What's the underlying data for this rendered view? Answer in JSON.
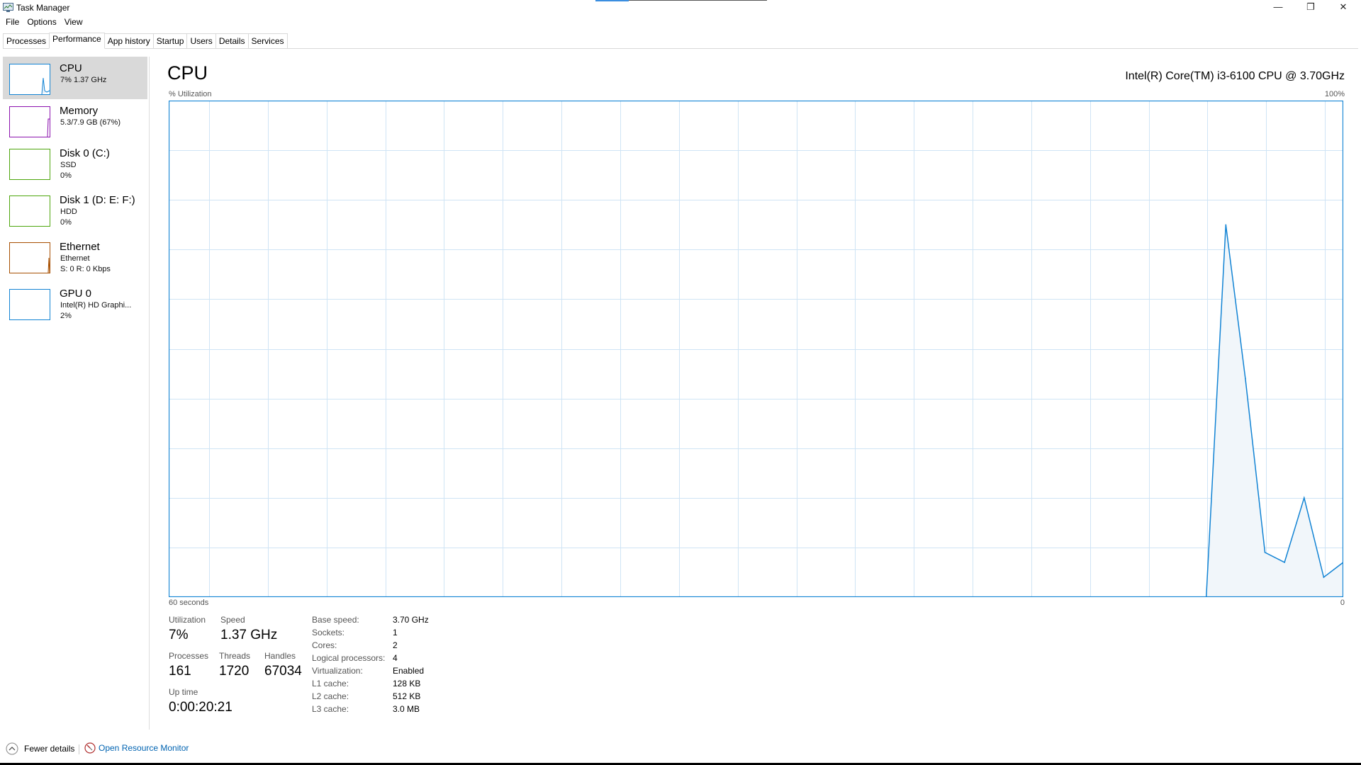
{
  "window": {
    "title": "Task Manager",
    "controls": {
      "minimize": "—",
      "restore": "❐",
      "close": "✕"
    }
  },
  "menu": [
    "File",
    "Options",
    "View"
  ],
  "tabs": [
    "Processes",
    "Performance",
    "App history",
    "Startup",
    "Users",
    "Details",
    "Services"
  ],
  "active_tab": "Performance",
  "sidebar": [
    {
      "name": "CPU",
      "line1": "7% 1.37 GHz",
      "line2": "",
      "color": "#1183d4",
      "selected": true
    },
    {
      "name": "Memory",
      "line1": "5.3/7.9 GB (67%)",
      "line2": "",
      "color": "#8b12ae",
      "selected": false
    },
    {
      "name": "Disk 0 (C:)",
      "line1": "SSD",
      "line2": "0%",
      "color": "#4da60c",
      "selected": false
    },
    {
      "name": "Disk 1 (D: E: F:)",
      "line1": "HDD",
      "line2": "0%",
      "color": "#4da60c",
      "selected": false
    },
    {
      "name": "Ethernet",
      "line1": "Ethernet",
      "line2": "S: 0 R: 0 Kbps",
      "color": "#a74f01",
      "selected": false
    },
    {
      "name": "GPU 0",
      "line1": "Intel(R) HD Graphi...",
      "line2": "2%",
      "color": "#1183d4",
      "selected": false
    }
  ],
  "main": {
    "title": "CPU",
    "cpu_model": "Intel(R) Core(TM) i3-6100 CPU @ 3.70GHz",
    "y_label": "% Utilization",
    "y_max_label": "100%",
    "x_left_label": "60 seconds",
    "x_right_label": "0"
  },
  "chart_data": {
    "type": "area",
    "title": "CPU",
    "ylabel": "% Utilization",
    "xlabel": "60 seconds",
    "xlim": [
      60,
      0
    ],
    "ylim": [
      0,
      100
    ],
    "grid": true,
    "x": [
      60,
      7,
      6,
      5,
      4,
      3,
      2,
      1,
      0
    ],
    "values": [
      0,
      0,
      75,
      44,
      9,
      7,
      20,
      4,
      7
    ],
    "color": "#1183d4",
    "fill": "#f1f6fa"
  },
  "stats": {
    "utilization": {
      "label": "Utilization",
      "value": "7%"
    },
    "speed": {
      "label": "Speed",
      "value": "1.37 GHz"
    },
    "processes": {
      "label": "Processes",
      "value": "161"
    },
    "threads": {
      "label": "Threads",
      "value": "1720"
    },
    "handles": {
      "label": "Handles",
      "value": "67034"
    },
    "uptime": {
      "label": "Up time",
      "value": "0:00:20:21"
    }
  },
  "specs": [
    {
      "label": "Base speed:",
      "value": "3.70 GHz"
    },
    {
      "label": "Sockets:",
      "value": "1"
    },
    {
      "label": "Cores:",
      "value": "2"
    },
    {
      "label": "Logical processors:",
      "value": "4"
    },
    {
      "label": "Virtualization:",
      "value": "Enabled"
    },
    {
      "label": "L1 cache:",
      "value": "128 KB"
    },
    {
      "label": "L2 cache:",
      "value": "512 KB"
    },
    {
      "label": "L3 cache:",
      "value": "3.0 MB"
    }
  ],
  "footer": {
    "fewer_details": "Fewer details",
    "open_resource_monitor": "Open Resource Monitor"
  }
}
